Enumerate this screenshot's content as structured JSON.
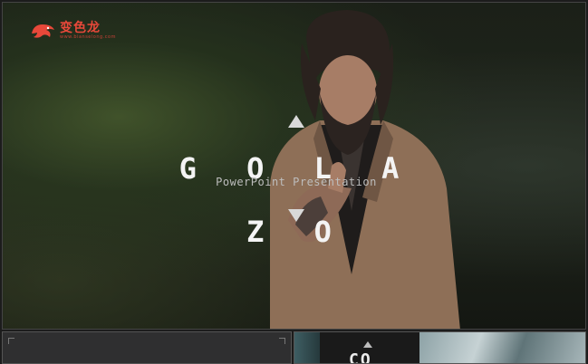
{
  "logo": {
    "text": "变色龙",
    "subtext": "www.bianselong.com"
  },
  "slide": {
    "title": "G O L A Z O",
    "subtitle": "PowerPoint Presentation"
  },
  "thumbnails": [
    {
      "label": ""
    },
    {
      "label": "CO"
    }
  ],
  "colors": {
    "brand": "#e8483a",
    "title": "#f4f4f4",
    "subtitle": "#bdbdbd",
    "accent_triangle": "#d9d9d9"
  }
}
